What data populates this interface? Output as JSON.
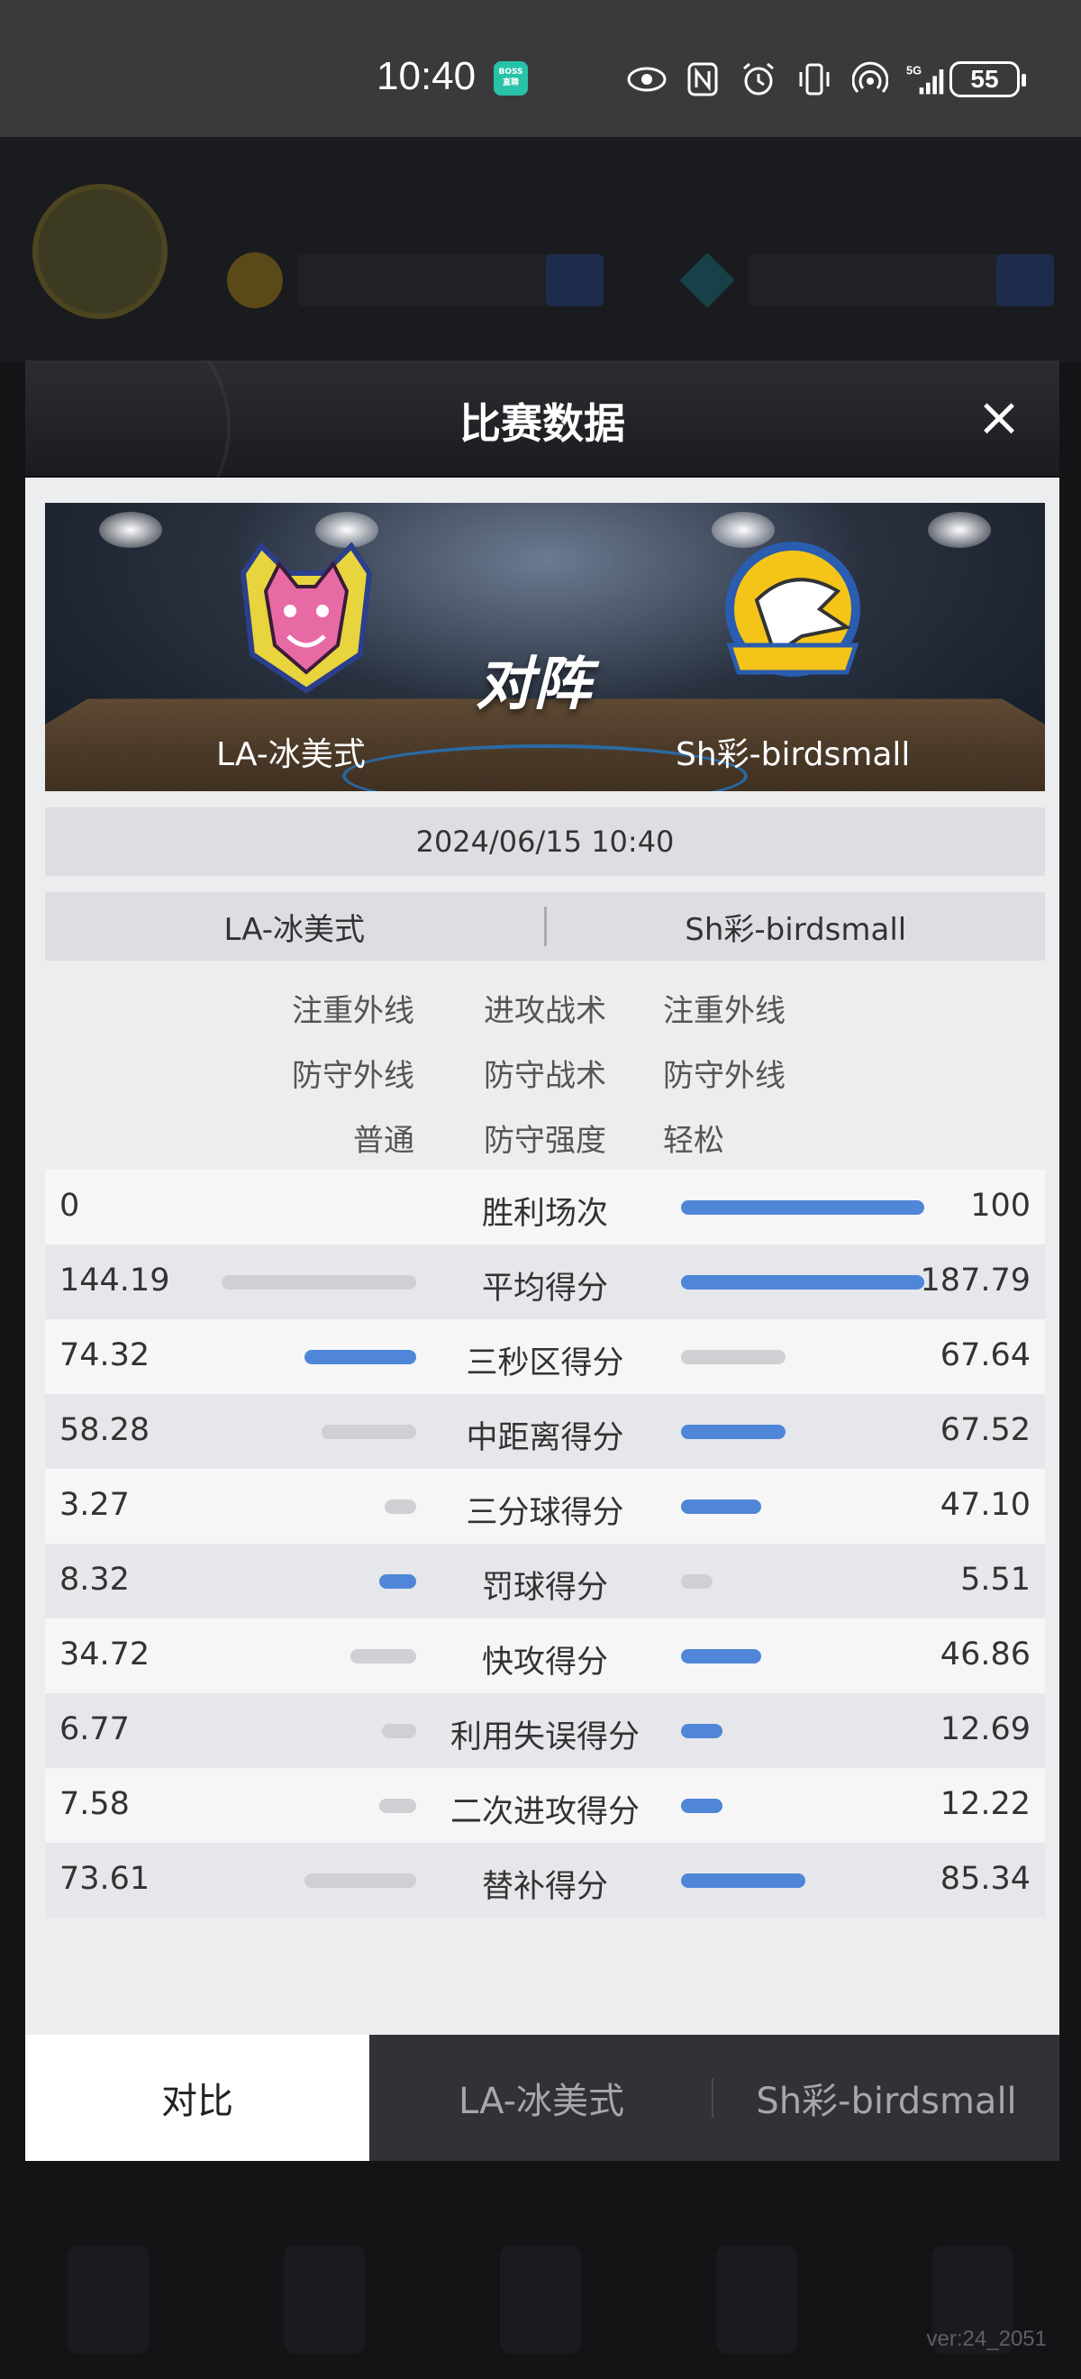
{
  "status_bar": {
    "time": "10:40",
    "boss_badge": "BOSS\n直聘",
    "battery": "55",
    "signal": "5G"
  },
  "background": {
    "version": "ver:24_2051"
  },
  "modal": {
    "title": "比赛数据",
    "close_icon": "close-icon",
    "matchup": {
      "vs_label": "对阵",
      "home_team": "LA-冰美式",
      "away_team": "Sh彩-birdsmall"
    },
    "date": "2024/06/15 10:40",
    "teams_header": {
      "left": "LA-冰美式",
      "right": "Sh彩-birdsmall"
    },
    "tactics": [
      {
        "left": "注重外线",
        "label": "进攻战术",
        "right": "注重外线"
      },
      {
        "left": "防守外线",
        "label": "防守战术",
        "right": "防守外线"
      },
      {
        "left": "普通",
        "label": "防守强度",
        "right": "轻松"
      }
    ],
    "stats": [
      {
        "label": "胜利场次",
        "left": "0",
        "right": "100",
        "left_frac": 0.0,
        "right_frac": 1.0,
        "left_color": "gray",
        "right_color": "blue"
      },
      {
        "label": "平均得分",
        "left": "144.19",
        "right": "187.79",
        "left_frac": 0.8,
        "right_frac": 1.0,
        "left_color": "gray",
        "right_color": "blue"
      },
      {
        "label": "三秒区得分",
        "left": "74.32",
        "right": "67.64",
        "left_frac": 0.46,
        "right_frac": 0.43,
        "left_color": "blue",
        "right_color": "gray"
      },
      {
        "label": "中距离得分",
        "left": "58.28",
        "right": "67.52",
        "left_frac": 0.39,
        "right_frac": 0.43,
        "left_color": "gray",
        "right_color": "blue"
      },
      {
        "label": "三分球得分",
        "left": "3.27",
        "right": "47.10",
        "left_frac": 0.13,
        "right_frac": 0.33,
        "left_color": "gray",
        "right_color": "blue"
      },
      {
        "label": "罚球得分",
        "left": "8.32",
        "right": "5.51",
        "left_frac": 0.15,
        "right_frac": 0.13,
        "left_color": "blue",
        "right_color": "gray"
      },
      {
        "label": "快攻得分",
        "left": "34.72",
        "right": "46.86",
        "left_frac": 0.27,
        "right_frac": 0.33,
        "left_color": "gray",
        "right_color": "blue"
      },
      {
        "label": "利用失误得分",
        "left": "6.77",
        "right": "12.69",
        "left_frac": 0.14,
        "right_frac": 0.17,
        "left_color": "gray",
        "right_color": "blue"
      },
      {
        "label": "二次进攻得分",
        "left": "7.58",
        "right": "12.22",
        "left_frac": 0.15,
        "right_frac": 0.17,
        "left_color": "gray",
        "right_color": "blue"
      },
      {
        "label": "替补得分",
        "left": "73.61",
        "right": "85.34",
        "left_frac": 0.46,
        "right_frac": 0.51,
        "left_color": "gray",
        "right_color": "blue"
      }
    ],
    "tabs": [
      {
        "label": "对比",
        "active": true
      },
      {
        "label": "LA-冰美式",
        "active": false
      },
      {
        "label": "Sh彩-birdsmall",
        "active": false
      }
    ]
  },
  "colors": {
    "bar_blue": "#4f86d8",
    "bar_gray": "#cfd0d3",
    "header_dark": "#2c2d31"
  }
}
